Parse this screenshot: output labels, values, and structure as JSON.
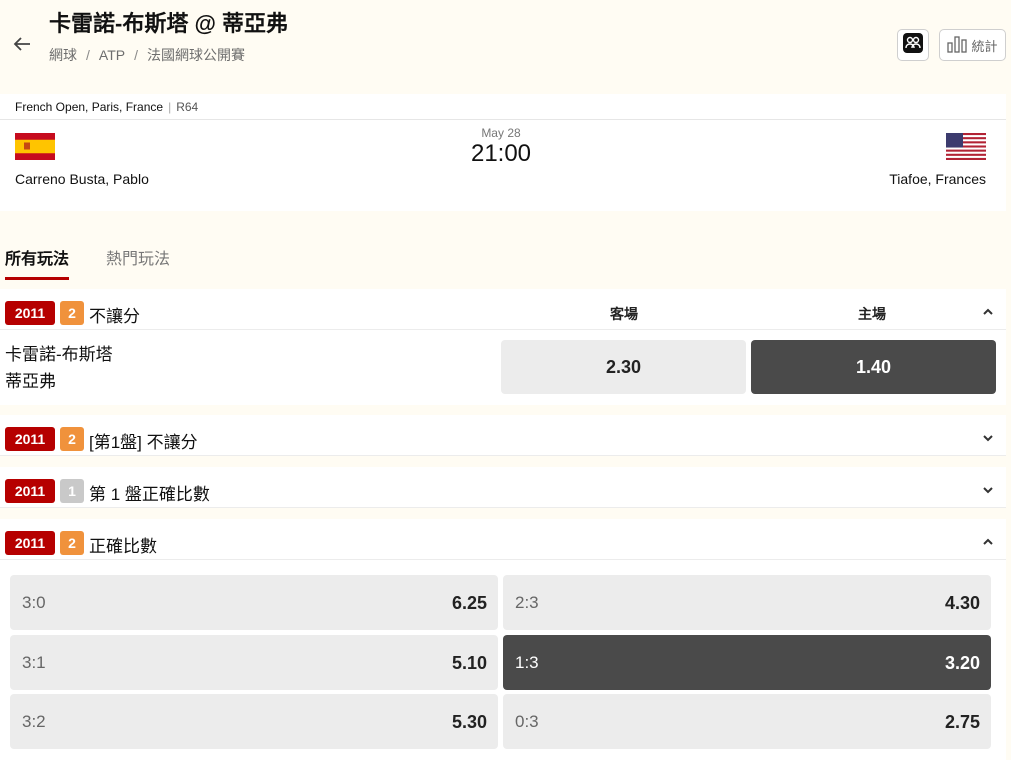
{
  "header": {
    "title": "卡雷諾-布斯塔 @ 蒂亞弗",
    "breadcrumbs": [
      "網球",
      "ATP",
      "法國網球公開賽"
    ],
    "stats_label": "統計",
    "lineup_icon": "lineup-icon",
    "stats_icon": "bar-chart-icon"
  },
  "match": {
    "tournament": "French Open, Paris, France",
    "round": "R64",
    "date": "May 28",
    "time": "21:00",
    "away_player": "Carreno Busta, Pablo",
    "home_player": "Tiafoe, Frances",
    "away_flag": "spain-flag",
    "home_flag": "usa-flag"
  },
  "tabs": [
    {
      "label": "所有玩法",
      "active": true
    },
    {
      "label": "熱門玩法",
      "active": false
    }
  ],
  "markets": [
    {
      "id": "2011",
      "count": "2",
      "title": "不讓分",
      "expanded": true,
      "col_away": "客場",
      "col_home": "主場",
      "player_away": "卡雷諾-布斯塔",
      "player_home": "蒂亞弗",
      "odds_away": "2.30",
      "odds_home": "1.40",
      "selected": "home"
    },
    {
      "id": "2011",
      "count": "2",
      "title": "[第1盤] 不讓分",
      "expanded": false
    },
    {
      "id": "2011",
      "count": "1",
      "title": "第 1 盤正確比數",
      "expanded": false
    },
    {
      "id": "2011",
      "count": "2",
      "title": "正確比數",
      "expanded": true,
      "scores": [
        {
          "score": "3:0",
          "odds": "6.25",
          "selected": false
        },
        {
          "score": "2:3",
          "odds": "4.30",
          "selected": false
        },
        {
          "score": "3:1",
          "odds": "5.10",
          "selected": false
        },
        {
          "score": "1:3",
          "odds": "3.20",
          "selected": true
        },
        {
          "score": "3:2",
          "odds": "5.30",
          "selected": false
        },
        {
          "score": "0:3",
          "odds": "2.75",
          "selected": false
        }
      ]
    }
  ],
  "colors": {
    "accent_red": "#b60000",
    "badge_orange": "#f0923c",
    "badge_grey": "#c9c9c9",
    "selected_dark": "#4a4a4a",
    "tile_light": "#ececec",
    "page_bg": "#fffcf3"
  }
}
